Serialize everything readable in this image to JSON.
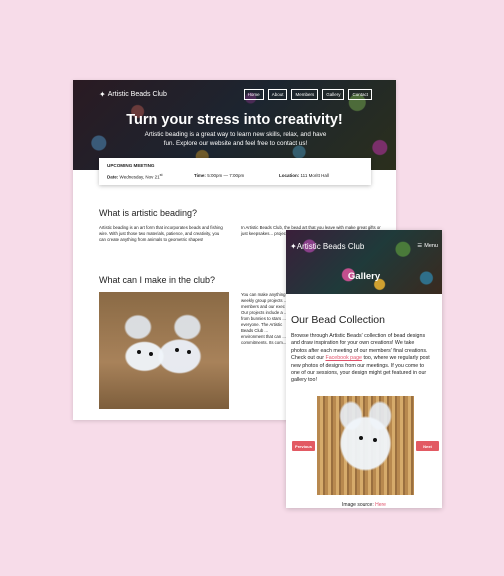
{
  "main": {
    "logo": "Artistic Beads Club",
    "nav": [
      "Home",
      "About",
      "Members",
      "Gallery",
      "Contact"
    ],
    "hero_title": "Turn your stress into creativity!",
    "hero_subtitle": "Artistic beading is a great way to learn new skills, relax, and have fun. Explore our website and feel free to contact us!",
    "meeting": {
      "heading": "UPCOMING MEETING",
      "date_label": "Date:",
      "date_value": "Wednesday, Nov 21",
      "date_suffix": "st",
      "time_label": "Time:",
      "time_value": "5:00pm — 7:00pm",
      "location_label": "Location:",
      "location_value": "111 Moritt Hall"
    },
    "section1_heading": "What is artistic beading?",
    "section1_left": "Artistic beading is an art form that incorporates beads and fishing wire. With just those two materials, patience, and creativity, you can create anything from animals to geometric shapes!",
    "section1_right": "In Artistic Beads Club, the bead art that you leave with make great gifts or just keepsakes... projects, so that all of ... what's coming up next",
    "section2_heading": "What can I make in the club?",
    "section2_right": "You can make anything ... weekly group projects ... members and our exec ... Our projects include a ... from bunnies to stars ... everyone. The Artistic Beads Club ... environment that can ... commitments. Its com..."
  },
  "gallery": {
    "logo": "Artistic Beads Club",
    "menu_label": "Menu",
    "title": "Gallery",
    "heading": "Our Bead Collection",
    "para_before_link": "Browse through Artistic Beads' collection of bead designs and draw inspiration for your own creations! We take photos after each meeting of our members' final creations. Check out our ",
    "link_text": "Facebook page",
    "para_after_link": " too, where we regularly post new photos of designs from our meetings. If you come to one of our sessions, your design might get featured in our gallery too!",
    "prev_label": "Previous",
    "next_label": "Next",
    "source_label": "Image source: ",
    "source_link": "Here"
  },
  "colors": {
    "background": "#f7dce9",
    "accent_button": "#e25a63",
    "link": "#e0526b"
  }
}
